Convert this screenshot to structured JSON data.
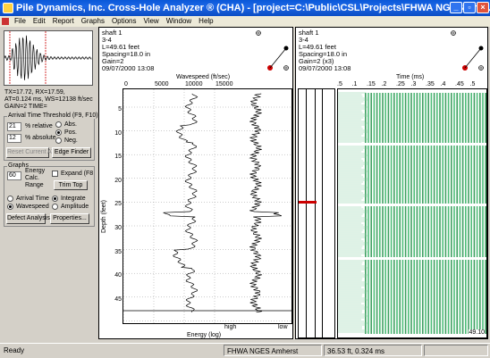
{
  "window": {
    "title": "Pile Dynamics, Inc. Cross-Hole Analyzer ® (CHA) - [project=C:\\Public\\CSL\\Projects\\FHWA NGES Amh…",
    "minimize": "_",
    "restore": "▫",
    "close": "×"
  },
  "menu": [
    "File",
    "Edit",
    "Report",
    "Graphs",
    "Options",
    "View",
    "Window",
    "Help"
  ],
  "left_panel": {
    "readout_line1": "TX=17.72, RX=17.59,",
    "readout_line2": "AT=0.124 ms, WS=12138 ft/sec",
    "readout_line3": "GAIN=2 TIME=",
    "threshold_group": "Arrival Time Threshold (F9, F10)",
    "relative_value": "21",
    "relative_label": "% relative",
    "absolute_value": "12",
    "absolute_label": "% absolute",
    "abs_label": "Abs.",
    "pos_label": "Pos.",
    "neg_label": "Neg.",
    "reset_btn": "Reset Current AT",
    "edge_btn": "Edge Finder",
    "graphs_group": "Graphs",
    "energy_value": "60",
    "energy_label_1": "Energy",
    "energy_label_2": "Calc.",
    "energy_label_3": "Range",
    "expand_label": "Expand (F8",
    "trim_btn": "Trim Top",
    "arrival_label": "Arrival Time",
    "wavespeed_label": "Wavespeed",
    "integrate_label": "Integrate",
    "amplitude_label": "Amplitude",
    "defect_btn": "Defect Analysis",
    "properties_btn": "Properties..."
  },
  "panel_info": {
    "shaft": "shaft 1",
    "profile": "3-4",
    "length": "L=49.61 feet",
    "spacing": "Spacing=18.0 in",
    "gain": "Gain=2",
    "date": "09/07/2000 13:08"
  },
  "panel2_info": {
    "shaft": "shaft 1",
    "profile": "3-4",
    "length": "L=49.61 feet",
    "spacing": "Spacing=18.0 in",
    "gain": "Gain=2 (x3)",
    "date": "09/07/2000 13:08"
  },
  "wave_chart": {
    "top_label": "Wavespeed (ft/sec)",
    "xticks": [
      "0",
      "5000",
      "10000",
      "15000"
    ],
    "ylabel": "Depth (feet)",
    "yticks": [
      "5",
      "10",
      "15",
      "20",
      "25",
      "30",
      "35",
      "40",
      "45"
    ],
    "energy_high": "high",
    "energy_low": "low",
    "energy_label": "Energy (log)"
  },
  "time_chart": {
    "top_label": "Time (ms)",
    "xticks": [
      ".5",
      ".1",
      ".15",
      ".2",
      ".25",
      ".3",
      ".35",
      ".4",
      ".45",
      ".5"
    ],
    "depth_readout": "49.10"
  },
  "status": {
    "ready": "Ready",
    "project": "FHWA NGES Amherst",
    "position": "36.53 ft, 0.324 ms"
  },
  "colors": {
    "titlebar": "#0a58d8",
    "green_trace": "#1a9a4a",
    "marker_red": "#cc0000"
  }
}
